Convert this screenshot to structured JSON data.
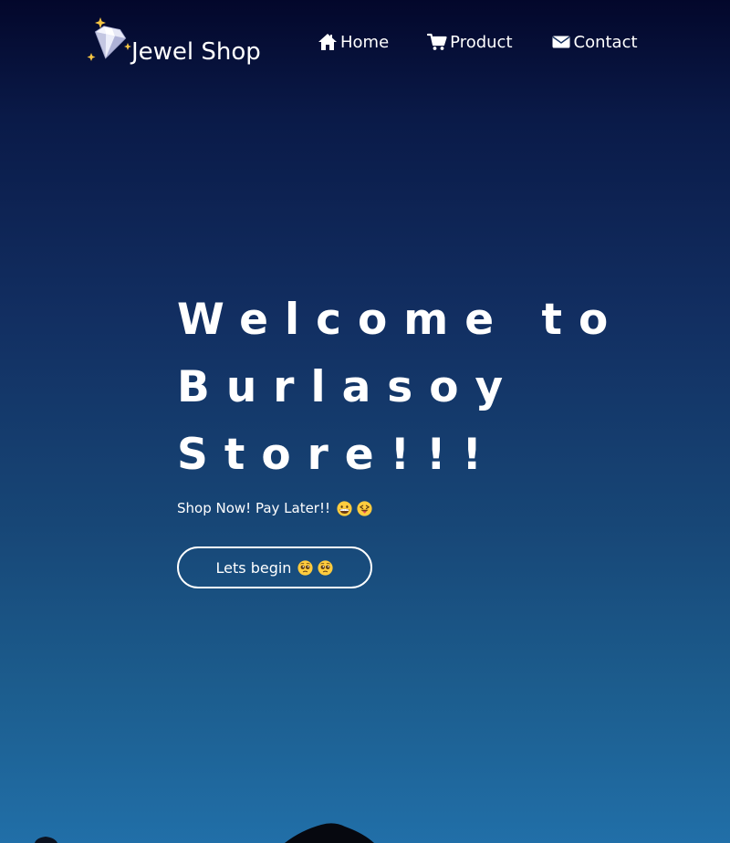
{
  "brand": {
    "name": "Jewel Shop",
    "logo_icon": "diamond-sparkles-icon"
  },
  "nav": {
    "items": [
      {
        "label": "Home",
        "icon": "home-icon"
      },
      {
        "label": "Product",
        "icon": "cart-icon"
      },
      {
        "label": "Contact",
        "icon": "envelope-icon"
      }
    ]
  },
  "hero": {
    "title_lines": [
      "Welcome to",
      "Burlasoy",
      "Store!!!"
    ],
    "subtitle": "Shop Now! Pay Later!!",
    "subtitle_emojis": [
      "grinning-face-emoji",
      "tongue-out-winking-face-emoji"
    ],
    "cta_label": "Lets begin",
    "cta_emojis": [
      "pleading-face-emoji",
      "pleading-face-emoji"
    ]
  },
  "colors": {
    "background_top": "#03072b",
    "background_bottom": "#216fa8",
    "text": "#ffffff"
  }
}
